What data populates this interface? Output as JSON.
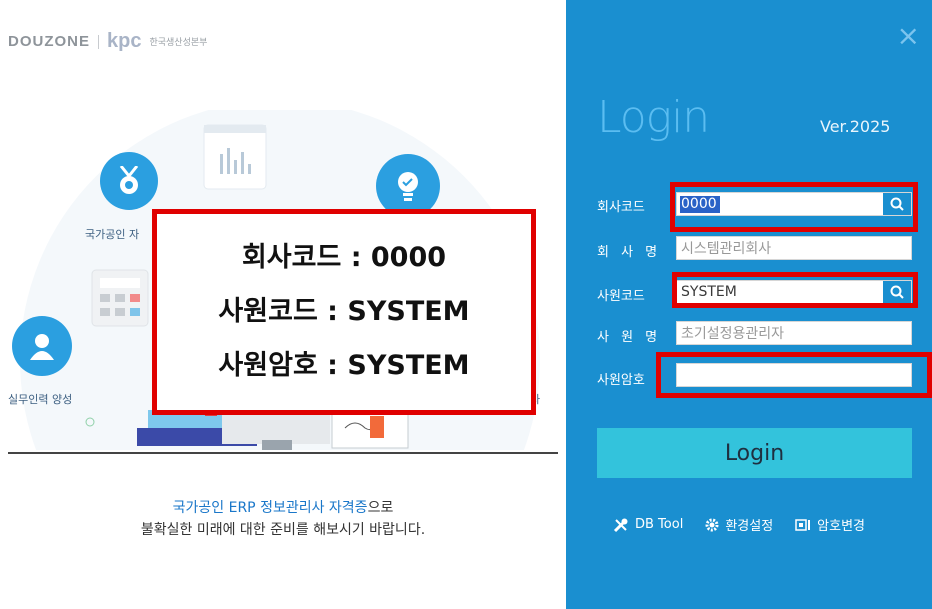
{
  "brand": {
    "douzone": "DOUZONE",
    "kpc": "kpc",
    "kpc_name": "한국생산성본부"
  },
  "illustration": {
    "label_national": "국가공인 자",
    "label_practical": "실무인력 양성",
    "label_right_partial": "사"
  },
  "promo": {
    "line1_highlight": "국가공인 ERP 정보관리사 자격증",
    "line1_rest": "으로",
    "line2": "불확실한 미래에 대한 준비를 해보시기 바랍니다."
  },
  "overlay": {
    "line1": "회사코드 : 0000",
    "line2": "사원코드 : SYSTEM",
    "line3": "사원암호 : SYSTEM"
  },
  "login_panel": {
    "close_glyph": "×",
    "title": "Login",
    "version": "Ver.2025",
    "company_code_label": "회사코드",
    "company_code_value": "0000",
    "company_name_label": "회 사 명",
    "company_name_value": "시스템관리회사",
    "employee_code_label": "사원코드",
    "employee_code_value": "SYSTEM",
    "employee_name_label": "사 원 명",
    "employee_name_value": "초기설정용관리자",
    "password_label": "사원암호",
    "password_value": "",
    "login_button": "Login",
    "tool_db": "DB Tool",
    "tool_env": "환경설정",
    "tool_pw": "암호변경"
  },
  "colors": {
    "panel_bg": "#1a8fd0",
    "login_button": "#33c3dc",
    "highlight_red": "#e00000",
    "title": "#5bbdf1"
  },
  "icons": [
    "search-icon",
    "wrench-icon",
    "gear-icon",
    "password-change-icon",
    "close-icon",
    "medal-icon",
    "lightbulb-icon",
    "person-icon",
    "chart-icon",
    "calculator-icon"
  ]
}
